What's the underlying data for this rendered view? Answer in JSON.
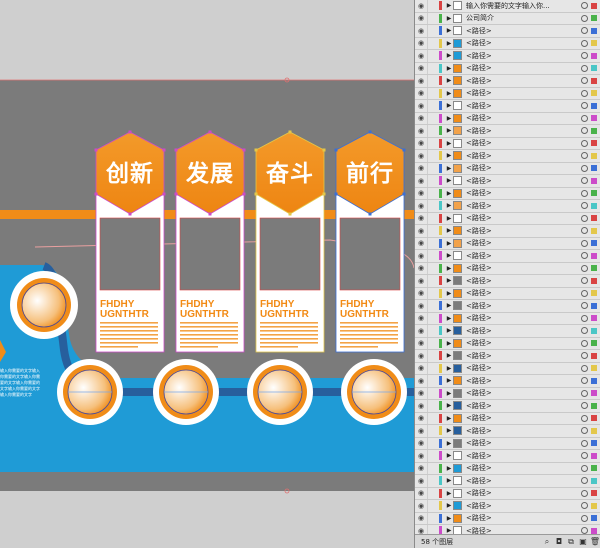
{
  "canvas": {
    "tiles": [
      {
        "hex_label": "创新",
        "latin_line1": "FHDHY",
        "latin_line2": "UGNTHTR"
      },
      {
        "hex_label": "发展",
        "latin_line1": "FHDHY",
        "latin_line2": "UGNTHTR"
      },
      {
        "hex_label": "奋斗",
        "latin_line1": "FHDHY",
        "latin_line2": "UGNTHTR"
      },
      {
        "hex_label": "前行",
        "latin_line1": "FHDHY",
        "latin_line2": "UGNTHTR"
      }
    ],
    "side_text": "输入你需要的文字输入你需要的文字输入你需要的文字输入你需要的文字输入你需要的文字输入你需要的文字",
    "colors": {
      "orange": "#f08c18",
      "blue": "#1f9bd6",
      "band_gray": "#7b7b7b",
      "dark_blue": "#275f9d"
    }
  },
  "layers_panel": {
    "rows": [
      {
        "name": "输入你需要的文字输入你...",
        "color": "#d94343",
        "swatch": "#ffffff"
      },
      {
        "name": "公司简介",
        "color": "#49b24a",
        "swatch": "#ffffff"
      },
      {
        "name": "<路径>",
        "color": "#3b6fd6",
        "swatch": "#ffffff"
      },
      {
        "name": "<路径>",
        "color": "#e3c74a",
        "swatch": "#1f9bd6"
      },
      {
        "name": "<路径>",
        "color": "#cc4bc9",
        "swatch": "#1f9bd6"
      },
      {
        "name": "<路径>",
        "color": "#4ac6c6",
        "swatch": "#f08c18"
      },
      {
        "name": "<路径>",
        "color": "#d94343",
        "swatch": "#f08c18"
      },
      {
        "name": "<路径>",
        "color": "#e3c74a",
        "swatch": "#f08c18"
      },
      {
        "name": "<路径>",
        "color": "#3b6fd6",
        "swatch": "#ffffff"
      },
      {
        "name": "<路径>",
        "color": "#cc4bc9",
        "swatch": "#f08c18"
      },
      {
        "name": "<路径>",
        "color": "#49b24a",
        "swatch": "#f2a24a"
      },
      {
        "name": "<路径>",
        "color": "#d94343",
        "swatch": "#ffffff"
      },
      {
        "name": "<路径>",
        "color": "#e3c74a",
        "swatch": "#f08c18"
      },
      {
        "name": "<路径>",
        "color": "#3b6fd6",
        "swatch": "#f2a24a"
      },
      {
        "name": "<路径>",
        "color": "#cc4bc9",
        "swatch": "#ffffff"
      },
      {
        "name": "<路径>",
        "color": "#49b24a",
        "swatch": "#f08c18"
      },
      {
        "name": "<路径>",
        "color": "#4ac6c6",
        "swatch": "#f2a24a"
      },
      {
        "name": "<路径>",
        "color": "#d94343",
        "swatch": "#ffffff"
      },
      {
        "name": "<路径>",
        "color": "#e3c74a",
        "swatch": "#f08c18"
      },
      {
        "name": "<路径>",
        "color": "#3b6fd6",
        "swatch": "#f2a24a"
      },
      {
        "name": "<路径>",
        "color": "#cc4bc9",
        "swatch": "#ffffff"
      },
      {
        "name": "<路径>",
        "color": "#49b24a",
        "swatch": "#f08c18"
      },
      {
        "name": "<路径>",
        "color": "#d94343",
        "swatch": "#7b7b7b"
      },
      {
        "name": "<路径>",
        "color": "#e3c74a",
        "swatch": "#f08c18"
      },
      {
        "name": "<路径>",
        "color": "#3b6fd6",
        "swatch": "#7b7b7b"
      },
      {
        "name": "<路径>",
        "color": "#cc4bc9",
        "swatch": "#f08c18"
      },
      {
        "name": "<路径>",
        "color": "#4ac6c6",
        "swatch": "#275f9d"
      },
      {
        "name": "<路径>",
        "color": "#49b24a",
        "swatch": "#f08c18"
      },
      {
        "name": "<路径>",
        "color": "#d94343",
        "swatch": "#7b7b7b"
      },
      {
        "name": "<路径>",
        "color": "#e3c74a",
        "swatch": "#275f9d"
      },
      {
        "name": "<路径>",
        "color": "#3b6fd6",
        "swatch": "#f08c18"
      },
      {
        "name": "<路径>",
        "color": "#cc4bc9",
        "swatch": "#7b7b7b"
      },
      {
        "name": "<路径>",
        "color": "#49b24a",
        "swatch": "#275f9d"
      },
      {
        "name": "<路径>",
        "color": "#d94343",
        "swatch": "#f08c18"
      },
      {
        "name": "<路径>",
        "color": "#e3c74a",
        "swatch": "#275f9d"
      },
      {
        "name": "<路径>",
        "color": "#3b6fd6",
        "swatch": "#7b7b7b"
      },
      {
        "name": "<路径>",
        "color": "#cc4bc9",
        "swatch": "#ffffff"
      },
      {
        "name": "<路径>",
        "color": "#49b24a",
        "swatch": "#1f9bd6"
      },
      {
        "name": "<路径>",
        "color": "#4ac6c6",
        "swatch": "#ffffff"
      },
      {
        "name": "<路径>",
        "color": "#d94343",
        "swatch": "#ffffff"
      },
      {
        "name": "<路径>",
        "color": "#e3c74a",
        "swatch": "#1f9bd6"
      },
      {
        "name": "<路径>",
        "color": "#3b6fd6",
        "swatch": "#f08c18"
      },
      {
        "name": "<路径>",
        "color": "#cc4bc9",
        "swatch": "#ffffff"
      }
    ],
    "footer": {
      "count_label": "58 个图层"
    }
  }
}
